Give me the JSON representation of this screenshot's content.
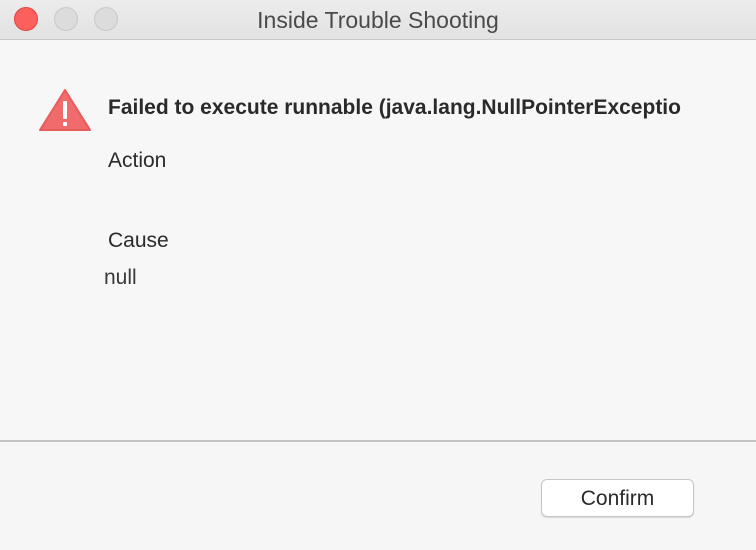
{
  "window": {
    "title": "Inside Trouble Shooting",
    "controls": {
      "close_color": "#fc605c",
      "minimize_color": "#dcdcdc",
      "maximize_color": "#dcdcdc"
    }
  },
  "dialog": {
    "icon": "warning-triangle-icon",
    "icon_color": "#f06b6b",
    "headline": "Failed to execute runnable (java.lang.NullPointerExceptio",
    "action_label": "Action",
    "cause_label": "Cause",
    "cause_value": "null"
  },
  "footer": {
    "confirm_label": "Confirm"
  }
}
